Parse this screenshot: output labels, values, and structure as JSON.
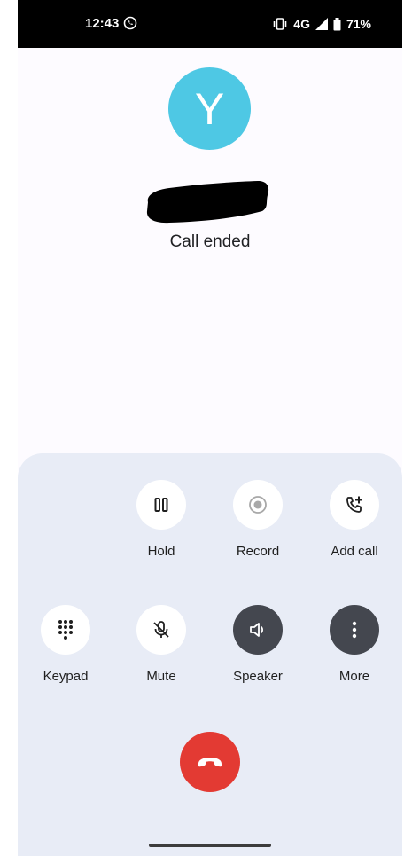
{
  "status_bar": {
    "time": "12:43",
    "network": "4G",
    "battery": "71%"
  },
  "contact": {
    "avatar_letter": "Y",
    "call_status": "Call ended"
  },
  "controls": {
    "hold": "Hold",
    "record": "Record",
    "add_call": "Add call",
    "keypad": "Keypad",
    "mute": "Mute",
    "speaker": "Speaker",
    "more": "More"
  },
  "colors": {
    "avatar": "#4ec8e4",
    "end_call": "#e33a33",
    "panel": "#e8ecf6",
    "dark_button": "#44474f"
  },
  "icons": [
    "whatsapp-icon",
    "vibrate-icon",
    "signal-icon",
    "battery-icon",
    "pause-icon",
    "record-icon",
    "add-call-icon",
    "dialpad-icon",
    "mic-off-icon",
    "speaker-icon",
    "more-vert-icon",
    "call-end-icon"
  ]
}
